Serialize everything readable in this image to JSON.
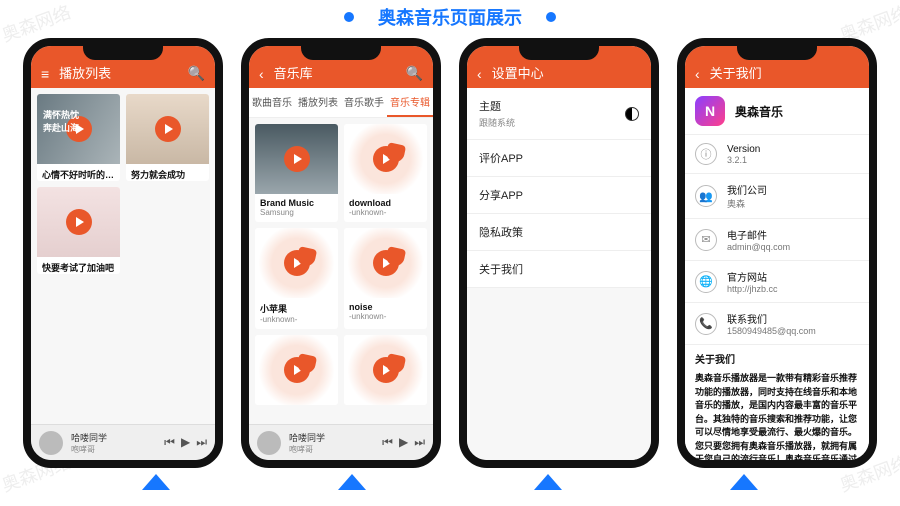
{
  "page_title": "奥森音乐页面展示",
  "watermark": "奥森网络",
  "colors": {
    "accent": "#e9572a",
    "brand_blue": "#1677ff"
  },
  "phone1": {
    "appbar": "播放列表",
    "cards": [
      {
        "title": "心情不好时听的歌曲",
        "sub": ""
      },
      {
        "title": "努力就会成功",
        "sub": ""
      },
      {
        "title": "快要考试了加油吧",
        "sub": ""
      }
    ],
    "nowplaying": {
      "title": "哈喽同学",
      "artist": "咆哮哥"
    }
  },
  "phone2": {
    "appbar": "音乐库",
    "tabs": [
      "歌曲音乐",
      "播放列表",
      "音乐歌手",
      "音乐专辑"
    ],
    "active_tab": 3,
    "albums": [
      {
        "title": "Brand Music",
        "sub": "Samsung"
      },
      {
        "title": "download",
        "sub": "-unknown-"
      },
      {
        "title": "小苹果",
        "sub": "-unknown-"
      },
      {
        "title": "noise",
        "sub": "-unknown-"
      }
    ],
    "nowplaying": {
      "title": "哈喽同学",
      "artist": "咆哮哥"
    }
  },
  "phone3": {
    "appbar": "设置中心",
    "theme_label": "主题",
    "theme_value": "跟随系统",
    "items": [
      "评价APP",
      "分享APP",
      "隐私政策",
      "关于我们"
    ]
  },
  "phone4": {
    "appbar": "关于我们",
    "app_name": "奥森音乐",
    "rows": [
      {
        "icon": "ⓘ",
        "label": "Version",
        "value": "3.2.1"
      },
      {
        "icon": "👥",
        "label": "我们公司",
        "value": "奥森"
      },
      {
        "icon": "✉",
        "label": "电子邮件",
        "value": "admin@qq.com"
      },
      {
        "icon": "🌐",
        "label": "官方网站",
        "value": "http://jhzb.cc"
      },
      {
        "icon": "📞",
        "label": "联系我们",
        "value": "1580949485@qq.com"
      }
    ],
    "about_heading": "关于我们",
    "about_body": "奥森音乐播放器是一款带有精彩音乐推荐功能的播放器，同时支持在线音乐和本地音乐的播放，是国内内容最丰富的音乐平台。其独特的音乐搜索和推荐功能，让您可以尽情地享受最流行、最火爆的音乐。您只要您拥有奥森音乐播放器，就拥有属于您自己的流行音乐！奥森音乐音乐通过贴心的设计、良好的体验、曲库、最新的流行音乐、专业的分类、丰富的"
  }
}
